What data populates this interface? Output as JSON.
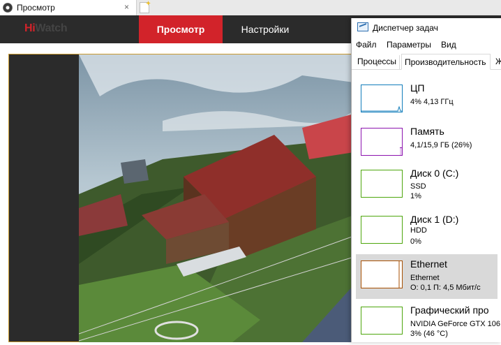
{
  "browser": {
    "tab_title": "Просмотр",
    "tab_close": "×"
  },
  "hiwatch": {
    "logo_prefix": "Hi",
    "logo_suffix": "Watch",
    "nav": [
      {
        "label": "Просмотр",
        "active": true
      },
      {
        "label": "Настройки",
        "active": false
      }
    ]
  },
  "task_manager": {
    "title": "Диспетчер задач",
    "menu": [
      "Файл",
      "Параметры",
      "Вид"
    ],
    "tabs": [
      "Процессы",
      "Производительность",
      "Ж"
    ],
    "rows": [
      {
        "name": "ЦП",
        "lines": [
          "4% 4,13 ГГц"
        ],
        "color": "#117dbb"
      },
      {
        "name": "Память",
        "lines": [
          "4,1/15,9 ГБ (26%)"
        ],
        "color": "#8b12ae"
      },
      {
        "name": "Диск 0 (C:)",
        "lines": [
          "SSD",
          "1%"
        ],
        "color": "#4da60c"
      },
      {
        "name": "Диск 1 (D:)",
        "lines": [
          "HDD",
          "0%"
        ],
        "color": "#4da60c"
      },
      {
        "name": "Ethernet",
        "lines": [
          "Ethernet",
          "О: 0,1 П: 4,5 Мбит/с"
        ],
        "color": "#a74f01",
        "selected": true
      },
      {
        "name": "Графический про",
        "lines": [
          "NVIDIA GeForce GTX 106",
          "3% (46 °C)"
        ],
        "color": "#4da60c"
      }
    ]
  },
  "colors": {
    "accent": "#d2232a",
    "header_bg": "#2b2b2b",
    "frame": "#c99a2e"
  }
}
